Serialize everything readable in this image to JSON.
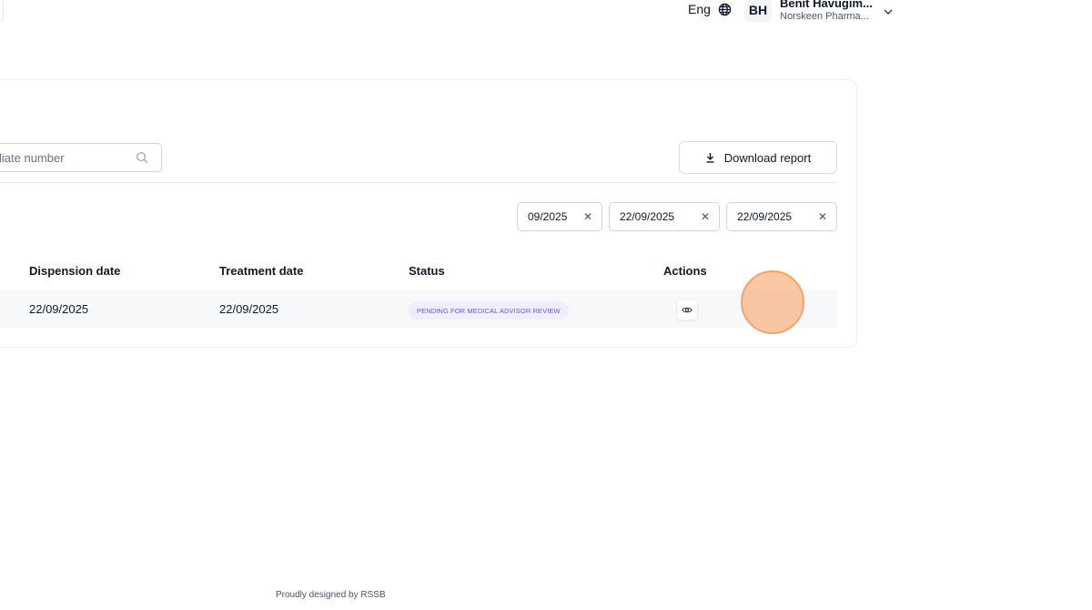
{
  "header": {
    "language": "Eng",
    "user": {
      "initials": "BH",
      "name": "Benit Havugim...",
      "org": "Norskeen Pharma..."
    }
  },
  "toolbar": {
    "search_placeholder": "liate number",
    "download_label": "Download report"
  },
  "filters": {
    "chips": [
      "09/2025",
      "22/09/2025",
      "22/09/2025"
    ],
    "clear_symbol": "✕"
  },
  "table": {
    "columns": [
      "Dispension date",
      "Treatment date",
      "Status",
      "Actions"
    ],
    "rows": [
      {
        "dispension_date": "22/09/2025",
        "treatment_date": "22/09/2025",
        "status": "PENDING FOR MEDICAL ADVISOR REVIEW"
      }
    ]
  },
  "footer": {
    "text": "Proudly designed by RSSB"
  }
}
